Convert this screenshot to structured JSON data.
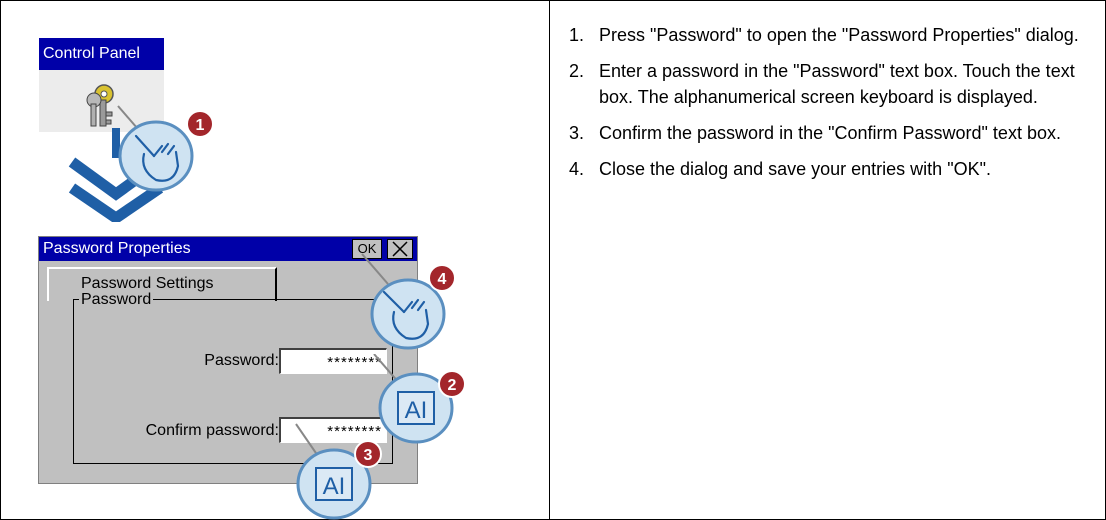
{
  "control_panel": {
    "title": "Control Panel",
    "icon": "keys-icon"
  },
  "dialog": {
    "title": "Password Properties",
    "ok_label": "OK",
    "close_icon": "close-icon",
    "tab_label": "Password Settings",
    "group_label": "Password",
    "password_label": "Password:",
    "password_value": "********",
    "confirm_label": "Confirm password:",
    "confirm_value": "********"
  },
  "callouts": [
    {
      "number": "1",
      "icon": "hand-touch-icon"
    },
    {
      "number": "2",
      "icon": "keyboard-ai-icon",
      "text": "AI"
    },
    {
      "number": "3",
      "icon": "keyboard-ai-icon",
      "text": "AI"
    },
    {
      "number": "4",
      "icon": "hand-touch-icon"
    }
  ],
  "colors": {
    "title_bar": "#0000a8",
    "callout_badge": "#a3262b",
    "callout_fill": "#cfe3f2",
    "arrow": "#1f5fa6"
  },
  "steps": [
    {
      "number": "1.",
      "text": "Press \"Password\" to open the \"Password Properties\" dialog."
    },
    {
      "number": "2.",
      "text": "Enter a password in the \"Password\" text box. Touch the text box. The alphanumerical screen keyboard is displayed."
    },
    {
      "number": "3.",
      "text": "Confirm the password in the \"Confirm Password\" text box."
    },
    {
      "number": "4.",
      "text": "Close the dialog and save your entries with \"OK\"."
    }
  ]
}
